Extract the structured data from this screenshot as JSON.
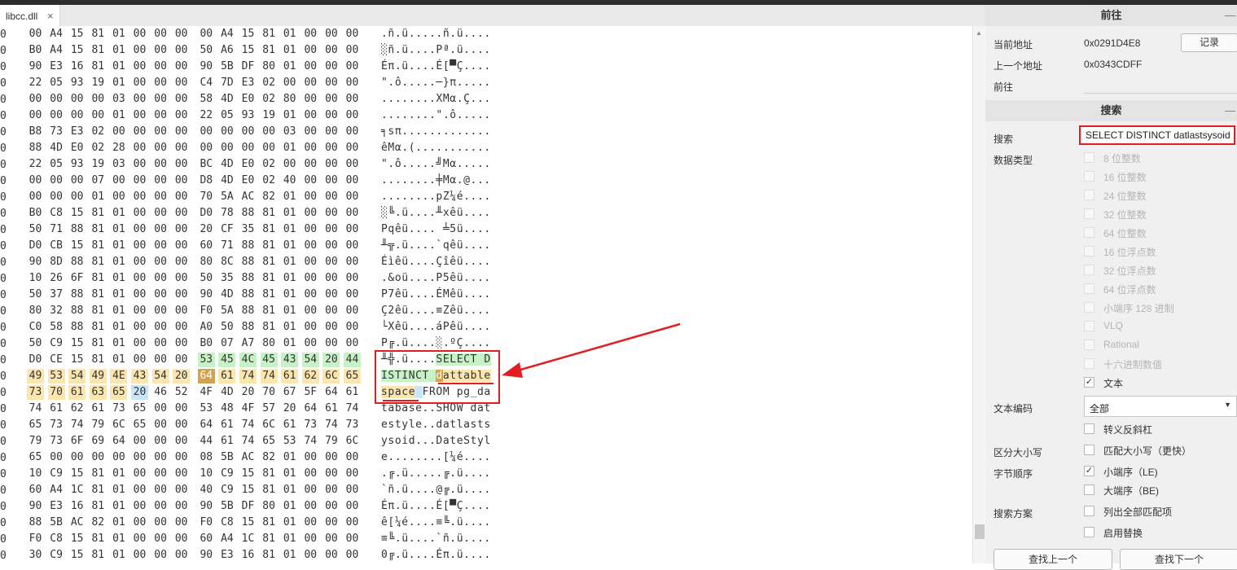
{
  "tab": {
    "title": "libcc.dll",
    "close": "×"
  },
  "hex": {
    "offset_digit": "0",
    "rows": [
      {
        "bytes": [
          "00",
          "A4",
          "15",
          "81",
          "01",
          "00",
          "00",
          "00",
          "00",
          "A4",
          "15",
          "81",
          "01",
          "00",
          "00",
          "00"
        ],
        "ascii": ".ñ.ü.....ñ.ü...."
      },
      {
        "bytes": [
          "B0",
          "A4",
          "15",
          "81",
          "01",
          "00",
          "00",
          "00",
          "50",
          "A6",
          "15",
          "81",
          "01",
          "00",
          "00",
          "00"
        ],
        "ascii": "░ñ.ü....Pª.ü...."
      },
      {
        "bytes": [
          "90",
          "E3",
          "16",
          "81",
          "01",
          "00",
          "00",
          "00",
          "90",
          "5B",
          "DF",
          "80",
          "01",
          "00",
          "00",
          "00"
        ],
        "ascii": "Éπ.ü....É[▀Ç...."
      },
      {
        "bytes": [
          "22",
          "05",
          "93",
          "19",
          "01",
          "00",
          "00",
          "00",
          "C4",
          "7D",
          "E3",
          "02",
          "00",
          "00",
          "00",
          "00"
        ],
        "ascii": "\".ô.....─}π....."
      },
      {
        "bytes": [
          "00",
          "00",
          "00",
          "00",
          "03",
          "00",
          "00",
          "00",
          "58",
          "4D",
          "E0",
          "02",
          "80",
          "00",
          "00",
          "00"
        ],
        "ascii": "........XMα.Ç..."
      },
      {
        "bytes": [
          "00",
          "00",
          "00",
          "00",
          "01",
          "00",
          "00",
          "00",
          "22",
          "05",
          "93",
          "19",
          "01",
          "00",
          "00",
          "00"
        ],
        "ascii": "........\".ô....."
      },
      {
        "bytes": [
          "B8",
          "73",
          "E3",
          "02",
          "00",
          "00",
          "00",
          "00",
          "00",
          "00",
          "00",
          "00",
          "03",
          "00",
          "00",
          "00"
        ],
        "ascii": "╕sπ............."
      },
      {
        "bytes": [
          "88",
          "4D",
          "E0",
          "02",
          "28",
          "00",
          "00",
          "00",
          "00",
          "00",
          "00",
          "00",
          "01",
          "00",
          "00",
          "00"
        ],
        "ascii": "êMα.(..........."
      },
      {
        "bytes": [
          "22",
          "05",
          "93",
          "19",
          "03",
          "00",
          "00",
          "00",
          "BC",
          "4D",
          "E0",
          "02",
          "00",
          "00",
          "00",
          "00"
        ],
        "ascii": "\".ô.....╝Mα....."
      },
      {
        "bytes": [
          "00",
          "00",
          "00",
          "07",
          "00",
          "00",
          "00",
          "00",
          "D8",
          "4D",
          "E0",
          "02",
          "40",
          "00",
          "00",
          "00"
        ],
        "ascii": "........╪Mα.@..."
      },
      {
        "bytes": [
          "00",
          "00",
          "00",
          "01",
          "00",
          "00",
          "00",
          "00",
          "70",
          "5A",
          "AC",
          "82",
          "01",
          "00",
          "00",
          "00"
        ],
        "ascii": "........pZ¼é...."
      },
      {
        "bytes": [
          "B0",
          "C8",
          "15",
          "81",
          "01",
          "00",
          "00",
          "00",
          "D0",
          "78",
          "88",
          "81",
          "01",
          "00",
          "00",
          "00"
        ],
        "ascii": "░╚.ü....╨xêü...."
      },
      {
        "bytes": [
          "50",
          "71",
          "88",
          "81",
          "01",
          "00",
          "00",
          "00",
          "20",
          "CF",
          "35",
          "81",
          "01",
          "00",
          "00",
          "00"
        ],
        "ascii": "Pqêü.... ╧5ü...."
      },
      {
        "bytes": [
          "D0",
          "CB",
          "15",
          "81",
          "01",
          "00",
          "00",
          "00",
          "60",
          "71",
          "88",
          "81",
          "01",
          "00",
          "00",
          "00"
        ],
        "ascii": "╨╦.ü....`qêü...."
      },
      {
        "bytes": [
          "90",
          "8D",
          "88",
          "81",
          "01",
          "00",
          "00",
          "00",
          "80",
          "8C",
          "88",
          "81",
          "01",
          "00",
          "00",
          "00"
        ],
        "ascii": "Éìêü....Çîêü...."
      },
      {
        "bytes": [
          "10",
          "26",
          "6F",
          "81",
          "01",
          "00",
          "00",
          "00",
          "50",
          "35",
          "88",
          "81",
          "01",
          "00",
          "00",
          "00"
        ],
        "ascii": ".&oü....P5êü...."
      },
      {
        "bytes": [
          "50",
          "37",
          "88",
          "81",
          "01",
          "00",
          "00",
          "00",
          "90",
          "4D",
          "88",
          "81",
          "01",
          "00",
          "00",
          "00"
        ],
        "ascii": "P7êü....ÉMêü...."
      },
      {
        "bytes": [
          "80",
          "32",
          "88",
          "81",
          "01",
          "00",
          "00",
          "00",
          "F0",
          "5A",
          "88",
          "81",
          "01",
          "00",
          "00",
          "00"
        ],
        "ascii": "Ç2êü....≡Zêü...."
      },
      {
        "bytes": [
          "C0",
          "58",
          "88",
          "81",
          "01",
          "00",
          "00",
          "00",
          "A0",
          "50",
          "88",
          "81",
          "01",
          "00",
          "00",
          "00"
        ],
        "ascii": "└Xêü....áPêü...."
      },
      {
        "bytes": [
          "50",
          "C9",
          "15",
          "81",
          "01",
          "00",
          "00",
          "00",
          "B0",
          "07",
          "A7",
          "80",
          "01",
          "00",
          "00",
          "00"
        ],
        "ascii": "P╔.ü....░.ºÇ...."
      },
      {
        "bytes": [
          "D0",
          "CE",
          "15",
          "81",
          "01",
          "00",
          "00",
          "00",
          "53",
          "45",
          "4C",
          "45",
          "43",
          "54",
          "20",
          "44"
        ],
        "ascii": "╨╬.ü....SELECT D"
      },
      {
        "bytes": [
          "49",
          "53",
          "54",
          "49",
          "4E",
          "43",
          "54",
          "20",
          "64",
          "61",
          "74",
          "74",
          "61",
          "62",
          "6C",
          "65"
        ],
        "ascii": "ISTINCT dattable"
      },
      {
        "bytes": [
          "73",
          "70",
          "61",
          "63",
          "65",
          "20",
          "46",
          "52",
          "4F",
          "4D",
          "20",
          "70",
          "67",
          "5F",
          "64",
          "61"
        ],
        "ascii": "space FROM pg_da"
      },
      {
        "bytes": [
          "74",
          "61",
          "62",
          "61",
          "73",
          "65",
          "00",
          "00",
          "53",
          "48",
          "4F",
          "57",
          "20",
          "64",
          "61",
          "74"
        ],
        "ascii": "tabase..SHOW dat"
      },
      {
        "bytes": [
          "65",
          "73",
          "74",
          "79",
          "6C",
          "65",
          "00",
          "00",
          "64",
          "61",
          "74",
          "6C",
          "61",
          "73",
          "74",
          "73"
        ],
        "ascii": "estyle..datlasts"
      },
      {
        "bytes": [
          "79",
          "73",
          "6F",
          "69",
          "64",
          "00",
          "00",
          "00",
          "44",
          "61",
          "74",
          "65",
          "53",
          "74",
          "79",
          "6C"
        ],
        "ascii": "ysoid...DateStyl"
      },
      {
        "bytes": [
          "65",
          "00",
          "00",
          "00",
          "00",
          "00",
          "00",
          "00",
          "08",
          "5B",
          "AC",
          "82",
          "01",
          "00",
          "00",
          "00"
        ],
        "ascii": "e........[¼é...."
      },
      {
        "bytes": [
          "10",
          "C9",
          "15",
          "81",
          "01",
          "00",
          "00",
          "00",
          "10",
          "C9",
          "15",
          "81",
          "01",
          "00",
          "00",
          "00"
        ],
        "ascii": ".╔.ü.....╔.ü...."
      },
      {
        "bytes": [
          "60",
          "A4",
          "1C",
          "81",
          "01",
          "00",
          "00",
          "00",
          "40",
          "C9",
          "15",
          "81",
          "01",
          "00",
          "00",
          "00"
        ],
        "ascii": "`ñ.ü....@╔.ü...."
      },
      {
        "bytes": [
          "90",
          "E3",
          "16",
          "81",
          "01",
          "00",
          "00",
          "00",
          "90",
          "5B",
          "DF",
          "80",
          "01",
          "00",
          "00",
          "00"
        ],
        "ascii": "Éπ.ü....É[▀Ç...."
      },
      {
        "bytes": [
          "88",
          "5B",
          "AC",
          "82",
          "01",
          "00",
          "00",
          "00",
          "F0",
          "C8",
          "15",
          "81",
          "01",
          "00",
          "00",
          "00"
        ],
        "ascii": "ê[¼é....≡╚.ü...."
      },
      {
        "bytes": [
          "F0",
          "C8",
          "15",
          "81",
          "01",
          "00",
          "00",
          "00",
          "60",
          "A4",
          "1C",
          "81",
          "01",
          "00",
          "00",
          "00"
        ],
        "ascii": "≡╚.ü....`ñ.ü...."
      },
      {
        "bytes": [
          "30",
          "C9",
          "15",
          "81",
          "01",
          "00",
          "00",
          "00",
          "90",
          "E3",
          "16",
          "81",
          "01",
          "00",
          "00",
          "00"
        ],
        "ascii": "0╔.ü....Éπ.ü...."
      }
    ]
  },
  "goto": {
    "title": "前往",
    "current_label": "当前地址",
    "current_value": "0x0291D4E8",
    "record_button": "记录",
    "prev_label": "上一个地址",
    "prev_value": "0x0343CDFF",
    "goto_label": "前往"
  },
  "search": {
    "title": "搜索",
    "search_label": "搜索",
    "search_value": "SELECT DISTINCT datlastsysoid",
    "datatype_label": "数据类型",
    "datatypes": [
      {
        "label": "8 位整数",
        "checked": false,
        "enabled": false
      },
      {
        "label": "16 位整数",
        "checked": false,
        "enabled": false
      },
      {
        "label": "24 位整数",
        "checked": false,
        "enabled": false
      },
      {
        "label": "32 位整数",
        "checked": false,
        "enabled": false
      },
      {
        "label": "64 位整数",
        "checked": false,
        "enabled": false
      },
      {
        "label": "16 位浮点数",
        "checked": false,
        "enabled": false
      },
      {
        "label": "32 位浮点数",
        "checked": false,
        "enabled": false
      },
      {
        "label": "64 位浮点数",
        "checked": false,
        "enabled": false
      },
      {
        "label": "小端序 128 进制",
        "checked": false,
        "enabled": false
      },
      {
        "label": "VLQ",
        "checked": false,
        "enabled": false
      },
      {
        "label": "Rational",
        "checked": false,
        "enabled": false
      },
      {
        "label": "十六进制数值",
        "checked": false,
        "enabled": false
      },
      {
        "label": "文本",
        "checked": true,
        "enabled": true
      }
    ],
    "encoding_label": "文本编码",
    "encoding_value": "全部",
    "escape_label": "转义反斜杠",
    "case_label": "区分大小写",
    "case_option": "匹配大小写（更快）",
    "byteorder_label": "字节顺序",
    "little_endian": "小端序（LE)",
    "big_endian": "大端序（BE)",
    "scheme_label": "搜索方案",
    "list_all": "列出全部匹配项",
    "enable_replace": "启用替换",
    "find_prev": "查找上一个",
    "find_next": "查找下一个"
  },
  "colors": {
    "highlight_red": "#e02020",
    "match_green": "#c6f2c6",
    "match_yellow": "#fbe6b0",
    "match_blue": "#c8e6fa",
    "cursor": "#d4a24a"
  }
}
